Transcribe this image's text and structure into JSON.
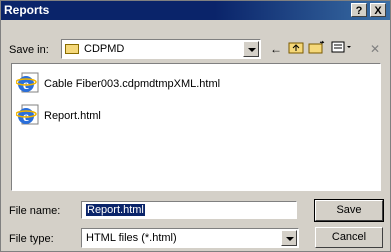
{
  "window": {
    "title": "Reports",
    "help_label": "?",
    "close_label": "X"
  },
  "savein": {
    "label": "Save in:",
    "value": "CDPMD"
  },
  "files": [
    {
      "name": "Cable Fiber003.cdpmdtmpXML.html",
      "icon": "ie-html-icon"
    },
    {
      "name": "Report.html",
      "icon": "ie-html-icon"
    }
  ],
  "filename": {
    "label": "File name:",
    "value": "Report.html"
  },
  "filetype": {
    "label": "File type:",
    "value": "HTML files (*.html)"
  },
  "buttons": {
    "save": "Save",
    "cancel": "Cancel"
  }
}
